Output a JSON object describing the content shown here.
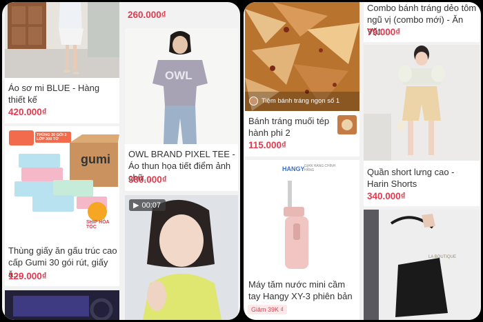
{
  "left_panel": {
    "top_price": "260.000₫",
    "products": [
      {
        "title": "Áo sơ mi BLUE - Hàng thiết kế",
        "price": "420.000₫"
      },
      {
        "title": "OWL BRAND PIXEL TEE - Áo thun họa tiết điểm ảnh chữ...",
        "price": "380.000₫",
        "print": "OWL"
      },
      {
        "title": "Thùng giấy ăn gấu trúc cao cấp Gumi 30 gói rút, giấy ă...",
        "price": "129.000₫",
        "brand": "gumi",
        "badge": "THÙNG 30 GÓI 3 LỚP 300 TỜ",
        "shipping": "SHIP HỎA TỐC"
      }
    ],
    "video": {
      "duration": "00:07"
    }
  },
  "right_panel": {
    "products": [
      {
        "title": "Bánh tráng muối tép hành phi 2",
        "price": "115.000₫",
        "shop": "Tiệm bánh tráng ngon số 1"
      },
      {
        "title": "Combo bánh tráng dẻo tôm ngũ vị (combo mới) - Ăn Vặt...",
        "price": "79.000₫"
      },
      {
        "title": "Quần short lưng cao - Harin Shorts",
        "price": "340.000₫"
      },
      {
        "title": "Máy tăm nước mini cầm tay Hangy XY-3 phiên bản 202...",
        "price": "",
        "brand": "HANGY",
        "brand_tag": "GIAN HÀNG CHÍNH HÃNG",
        "discount": "Giảm 39K ₫"
      }
    ],
    "bag_brand": "LA BOUTIQUE"
  },
  "colors": {
    "price": "#e23a4e",
    "panel_bg": "#f2f2f2",
    "text": "#333333"
  }
}
